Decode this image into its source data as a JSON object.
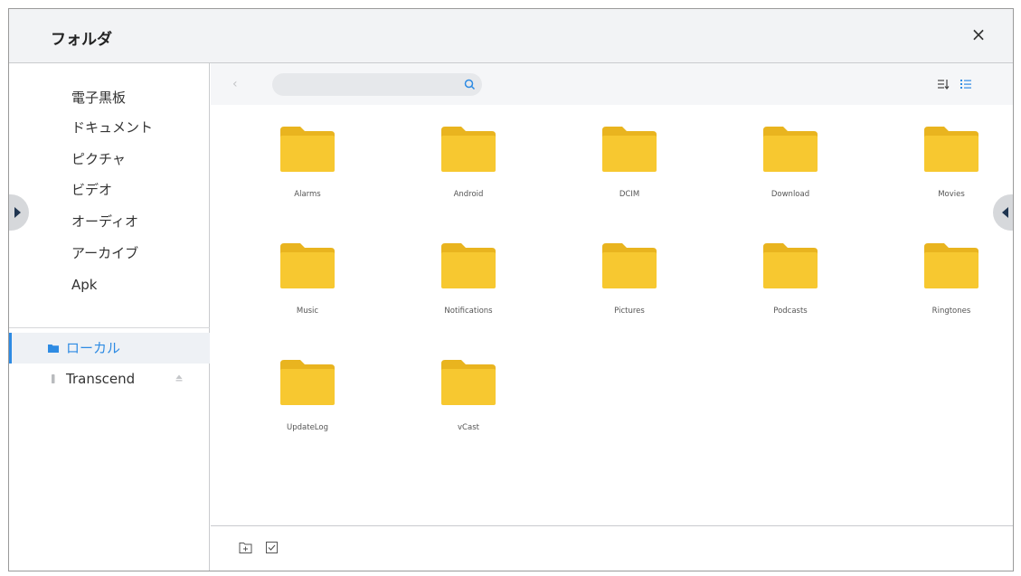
{
  "window": {
    "title": "フォルダ",
    "close_label": "×"
  },
  "sidebar": {
    "categories": [
      "電子黒板",
      "ドキュメント",
      "ピクチャ",
      "ビデオ",
      "オーディオ",
      "アーカイブ",
      "Apk"
    ],
    "storage": [
      {
        "label": "ローカル",
        "active": true,
        "icon": "folder-icon"
      },
      {
        "label": "Transcend",
        "active": false,
        "icon": "usb-drive-icon"
      }
    ]
  },
  "toolbar": {
    "back_label": "‹",
    "search_placeholder": "",
    "search_value": ""
  },
  "folders": [
    "Alarms",
    "Android",
    "DCIM",
    "Download",
    "Movies",
    "Music",
    "Notifications",
    "Pictures",
    "Podcasts",
    "Ringtones",
    "UpdateLog",
    "vCast"
  ],
  "colors": {
    "accent": "#2e8be3",
    "folder_body": "#f7c830",
    "folder_tab": "#e9b41f",
    "titlebar_bg": "#f2f3f5"
  }
}
